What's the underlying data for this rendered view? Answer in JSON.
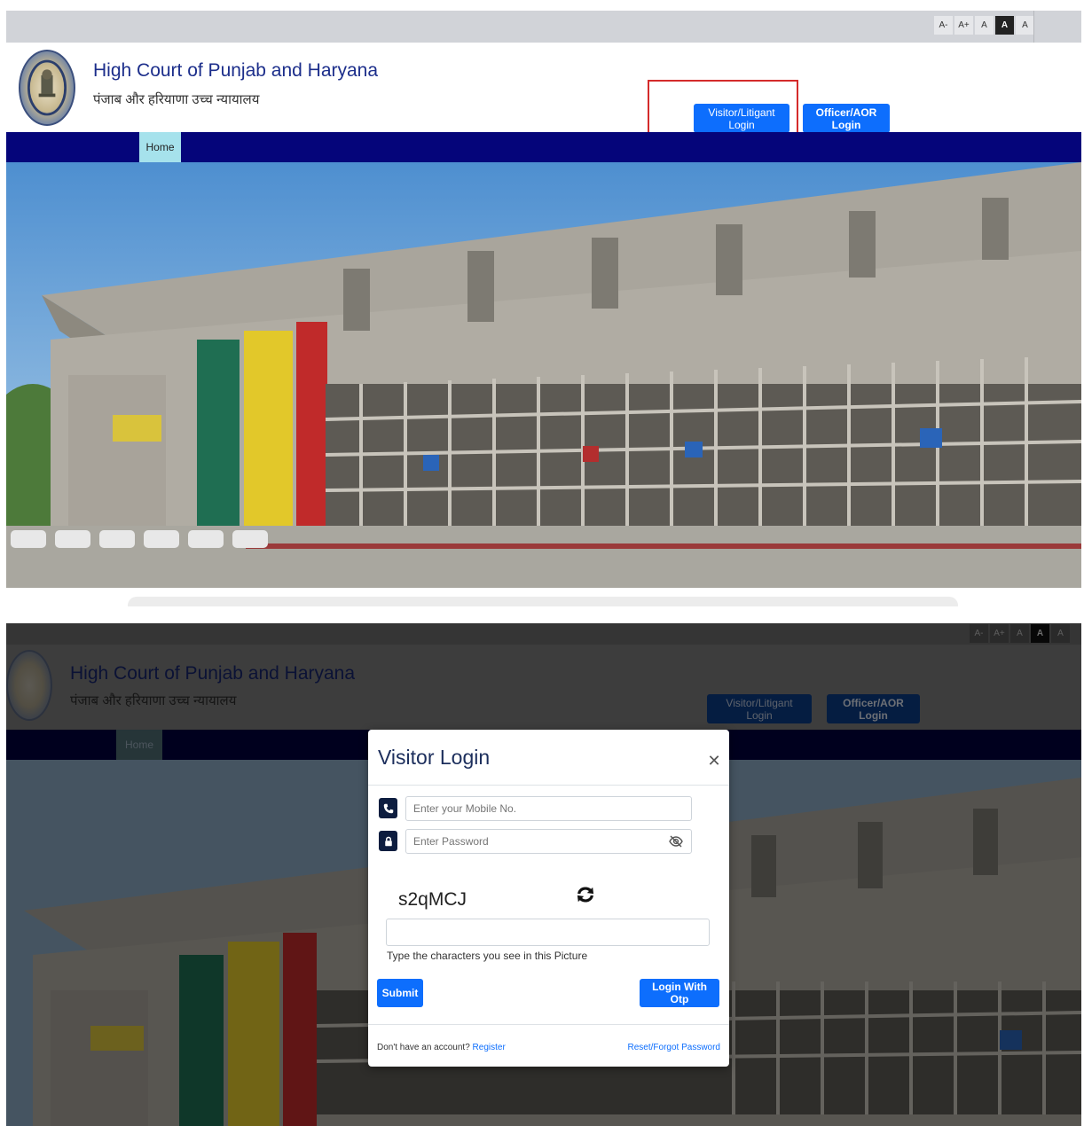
{
  "font_controls": [
    "A-",
    "A+",
    "A",
    "A",
    "A"
  ],
  "site": {
    "title": "High Court of Punjab and Haryana",
    "subtitle": "पंजाब और हरियाणा उच्च न्यायालय"
  },
  "header_buttons": {
    "visitor_login": "Visitor/Litigant Login",
    "officer_login": "Officer/AOR Login"
  },
  "nav": {
    "home": "Home"
  },
  "modal": {
    "title": "Visitor Login",
    "mobile_placeholder": "Enter your Mobile No.",
    "password_placeholder": "Enter Password",
    "captcha_text": "s2qMCJ",
    "captcha_hint": "Type the characters you see in this Picture",
    "submit_label": "Submit",
    "otp_label": "Login With Otp",
    "no_account_text": "Don't have an account?",
    "register_label": "Register",
    "reset_label": "Reset/Forgot Password"
  },
  "colors": {
    "primary_button": "#0d6efd",
    "navbar": "#05057a",
    "nav_active": "#a6e2ec",
    "highlight": "#d42b2b",
    "title_text": "#1c2e8b"
  }
}
